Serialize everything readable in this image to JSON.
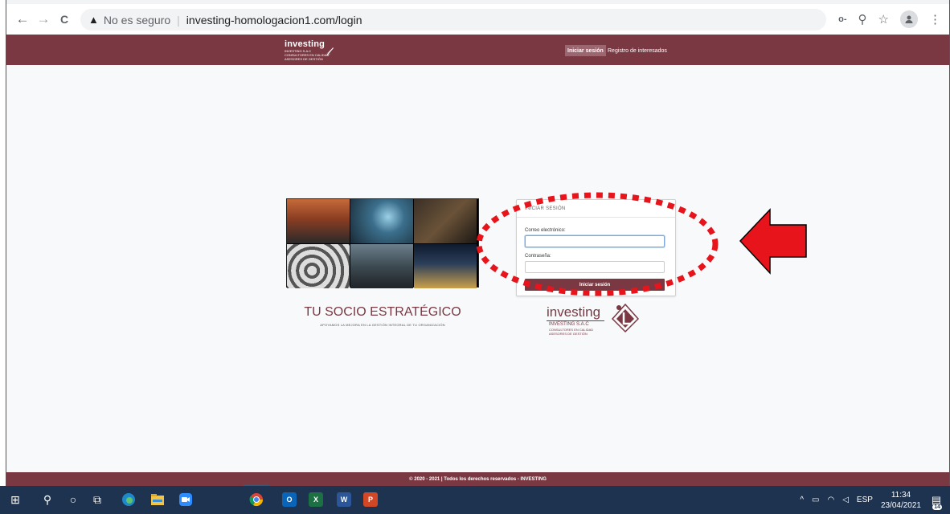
{
  "browser": {
    "back_icon": "←",
    "forward_icon": "→",
    "reload_icon": "C",
    "security_icon": "▲",
    "security_text": "No es seguro",
    "url": "investing-homologacion1.com/login",
    "key_icon": "o-",
    "zoom_icon": "⚲",
    "star_icon": "☆",
    "menu_icon": "⋮"
  },
  "header": {
    "logo_text": "investing",
    "logo_sub1": "INVESTING S.A.C",
    "logo_sub2": "CONSULTORES EN CALIDAD",
    "logo_sub3": "ASESORES DE GESTIÓN",
    "login_button": "Iniciar sesión",
    "register_link": "Registro de interesados"
  },
  "hero": {
    "tagline": "TU SOCIO ESTRATÉGICO",
    "subtagline": "APOYAMOS LA MEJORA EN LA GESTIÓN INTEGRAL DE TU ORGANIZACIÓN"
  },
  "login": {
    "title": "INICIAR SESIÓN",
    "email_label": "Correo electrónico:",
    "email_value": "",
    "password_label": "Contraseña:",
    "password_value": "",
    "submit_label": "Iniciar sesión"
  },
  "brand": {
    "word": "investing",
    "sub1": "INVESTING S.A.C",
    "sub2": "CONSULTORES EN CALIDAD",
    "sub3": "ASESORES DE GESTIÓN"
  },
  "footer": {
    "text": "© 2020 - 2021 | Todos los derechos reservados - INVESTING"
  },
  "taskbar": {
    "start_icon": "⊞",
    "search_icon": "⚲",
    "cortana_icon": "○",
    "taskview_icon": "⧉",
    "outlook_label": "O",
    "excel_label": "X",
    "word_label": "W",
    "powerpoint_label": "P",
    "tray_chevron": "^",
    "language": "ESP",
    "time": "11:34",
    "date": "23/04/2021",
    "notification_count": "14"
  },
  "colors": {
    "brand_maroon": "#7a3843",
    "annotation_red": "#e8141b",
    "taskbar": "#1d3350"
  }
}
